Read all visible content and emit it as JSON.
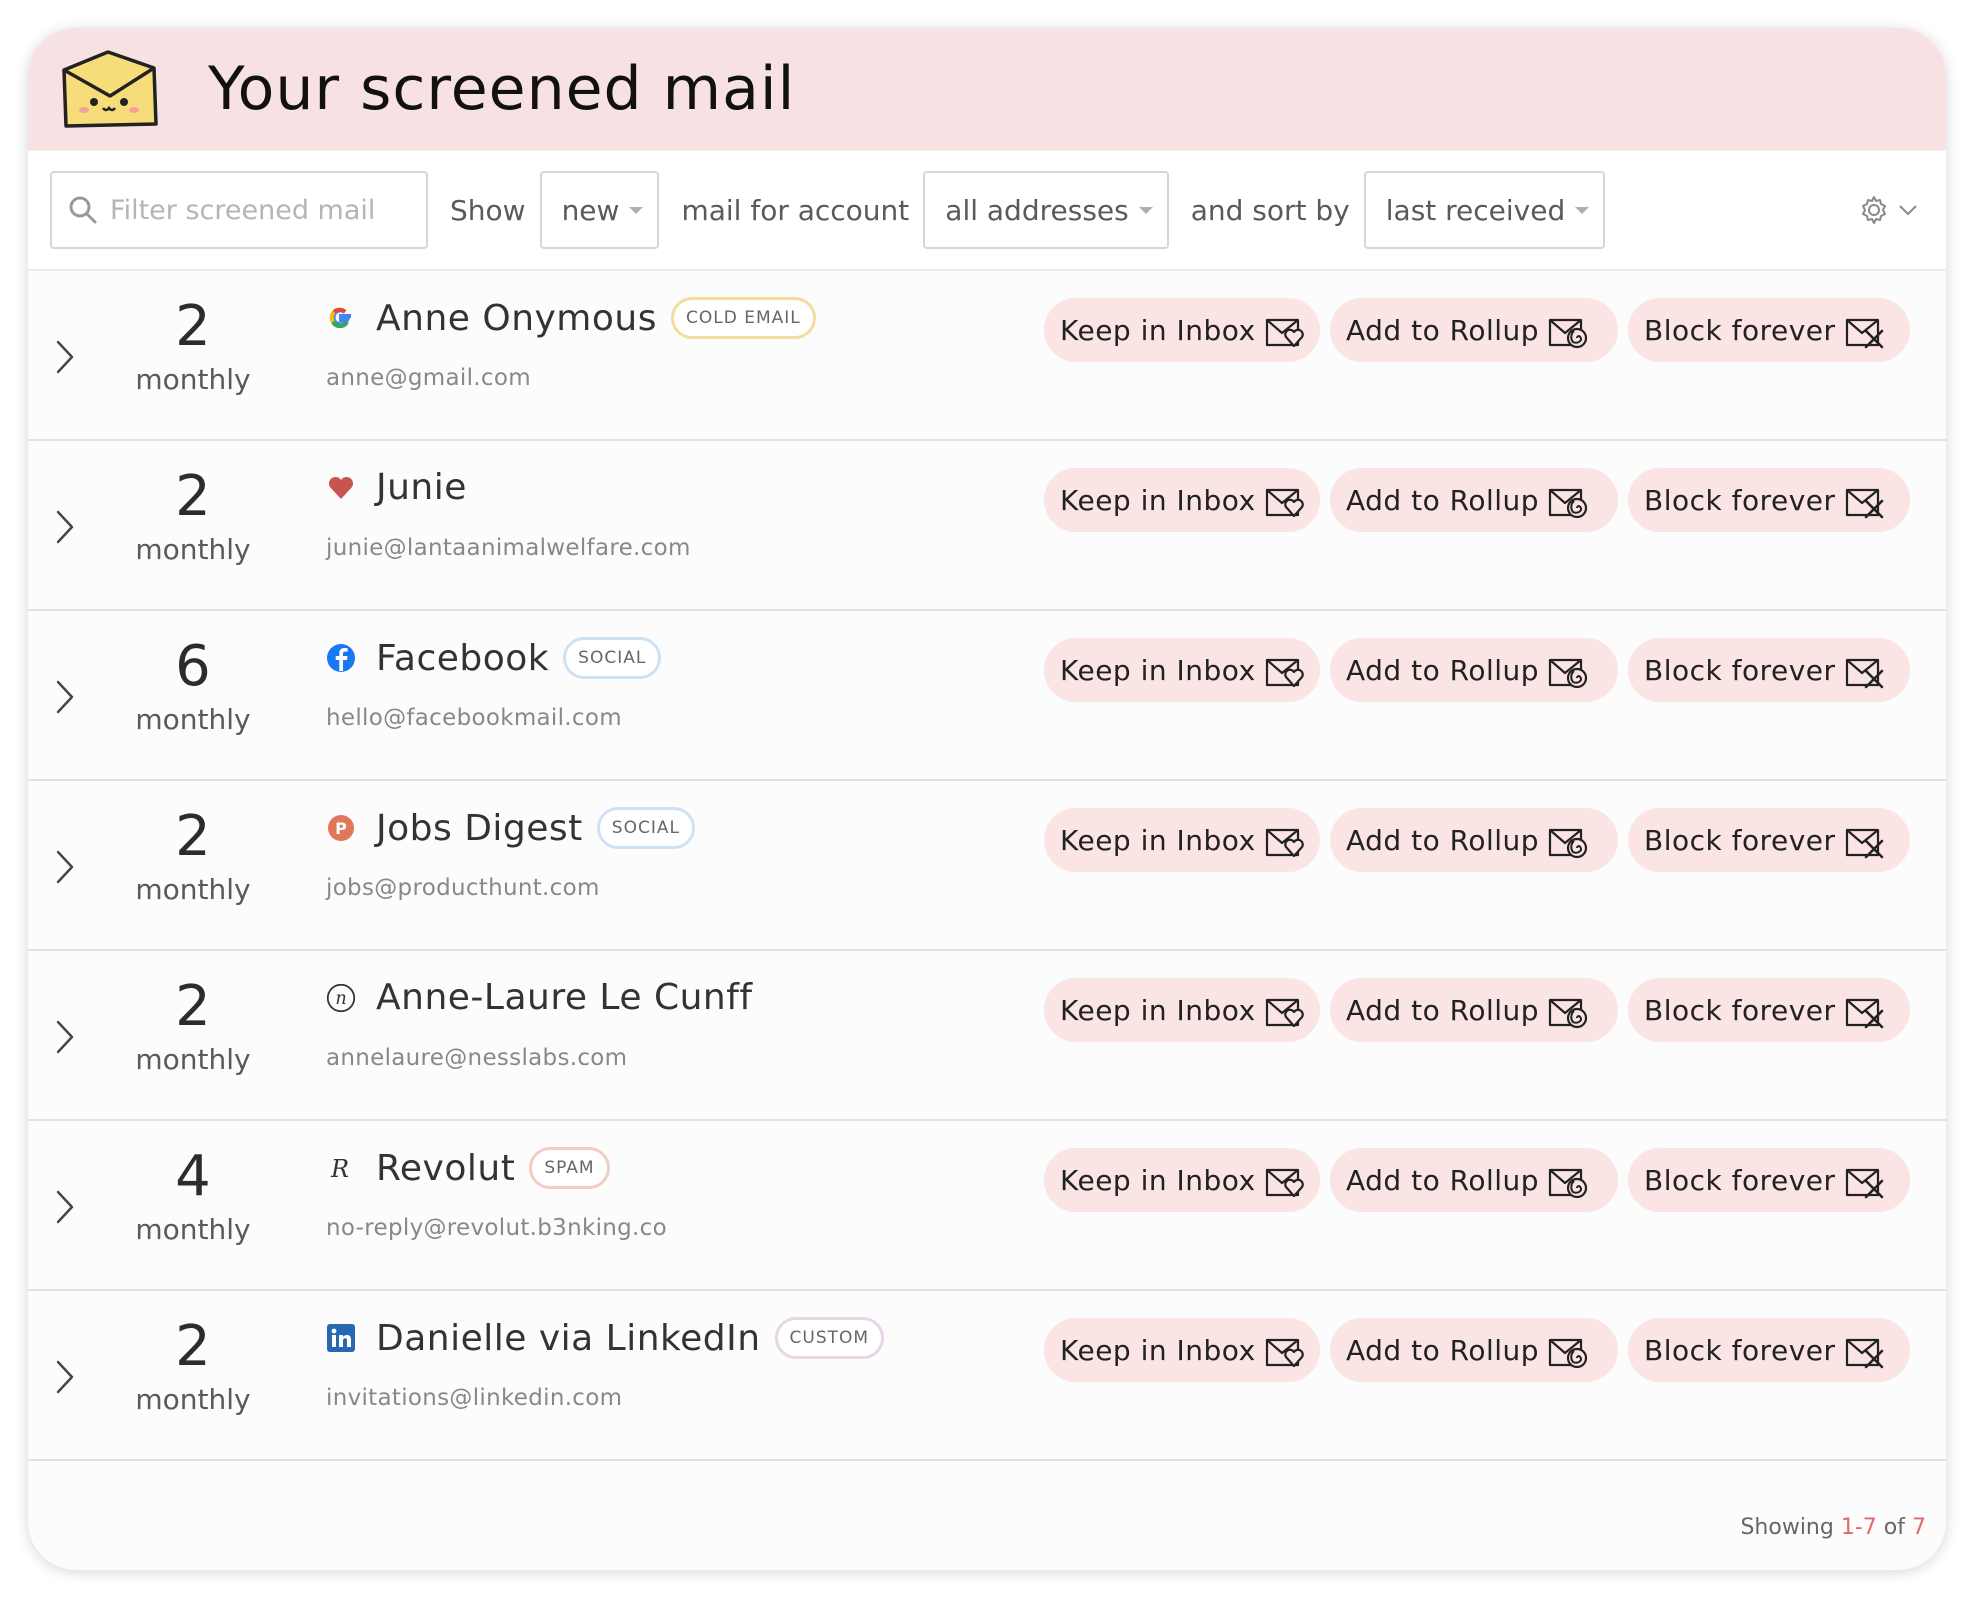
{
  "header": {
    "title": "Your screened mail"
  },
  "toolbar": {
    "search_placeholder": "Filter screened mail",
    "show_label": "Show",
    "show_value": "new",
    "account_label": "mail for account",
    "account_value": "all addresses",
    "sort_label": "and sort by",
    "sort_value": "last received"
  },
  "actions": {
    "keep": "Keep in Inbox",
    "rollup": "Add to Rollup",
    "block": "Block forever"
  },
  "rows": [
    {
      "count": "2",
      "frequency": "monthly",
      "name": "Anne Onymous",
      "badge": "COLD EMAIL",
      "email": "anne@gmail.com",
      "icon": "google-icon",
      "badge_color": "#f3dca0"
    },
    {
      "count": "2",
      "frequency": "monthly",
      "name": "Junie",
      "badge": "",
      "email": "junie@lantaanimalwelfare.com",
      "icon": "heart-icon",
      "badge_color": ""
    },
    {
      "count": "6",
      "frequency": "monthly",
      "name": "Facebook",
      "badge": "SOCIAL",
      "email": "hello@facebookmail.com",
      "icon": "facebook-icon",
      "badge_color": "#cfe1f5"
    },
    {
      "count": "2",
      "frequency": "monthly",
      "name": "Jobs Digest",
      "badge": "SOCIAL",
      "email": "jobs@producthunt.com",
      "icon": "producthunt-icon",
      "badge_color": "#cfe1f5"
    },
    {
      "count": "2",
      "frequency": "monthly",
      "name": "Anne-Laure Le Cunff",
      "badge": "",
      "email": "annelaure@nesslabs.com",
      "icon": "nesslabs-icon",
      "badge_color": ""
    },
    {
      "count": "4",
      "frequency": "monthly",
      "name": "Revolut",
      "badge": "SPAM",
      "email": "no-reply@revolut.b3nking.co",
      "icon": "revolut-icon",
      "badge_color": "#f3cfc2"
    },
    {
      "count": "2",
      "frequency": "monthly",
      "name": "Danielle via LinkedIn",
      "badge": "CUSTOM",
      "email": "invitations@linkedin.com",
      "icon": "linkedin-icon",
      "badge_color": "#e6d6e6"
    }
  ],
  "footer": {
    "prefix": "Showing",
    "range": "1-7",
    "of": "of",
    "total": "7"
  },
  "colors": {
    "header_bg": "#f8e1e2",
    "button_bg": "#fbe4e4",
    "accent": "#e06a6a"
  }
}
